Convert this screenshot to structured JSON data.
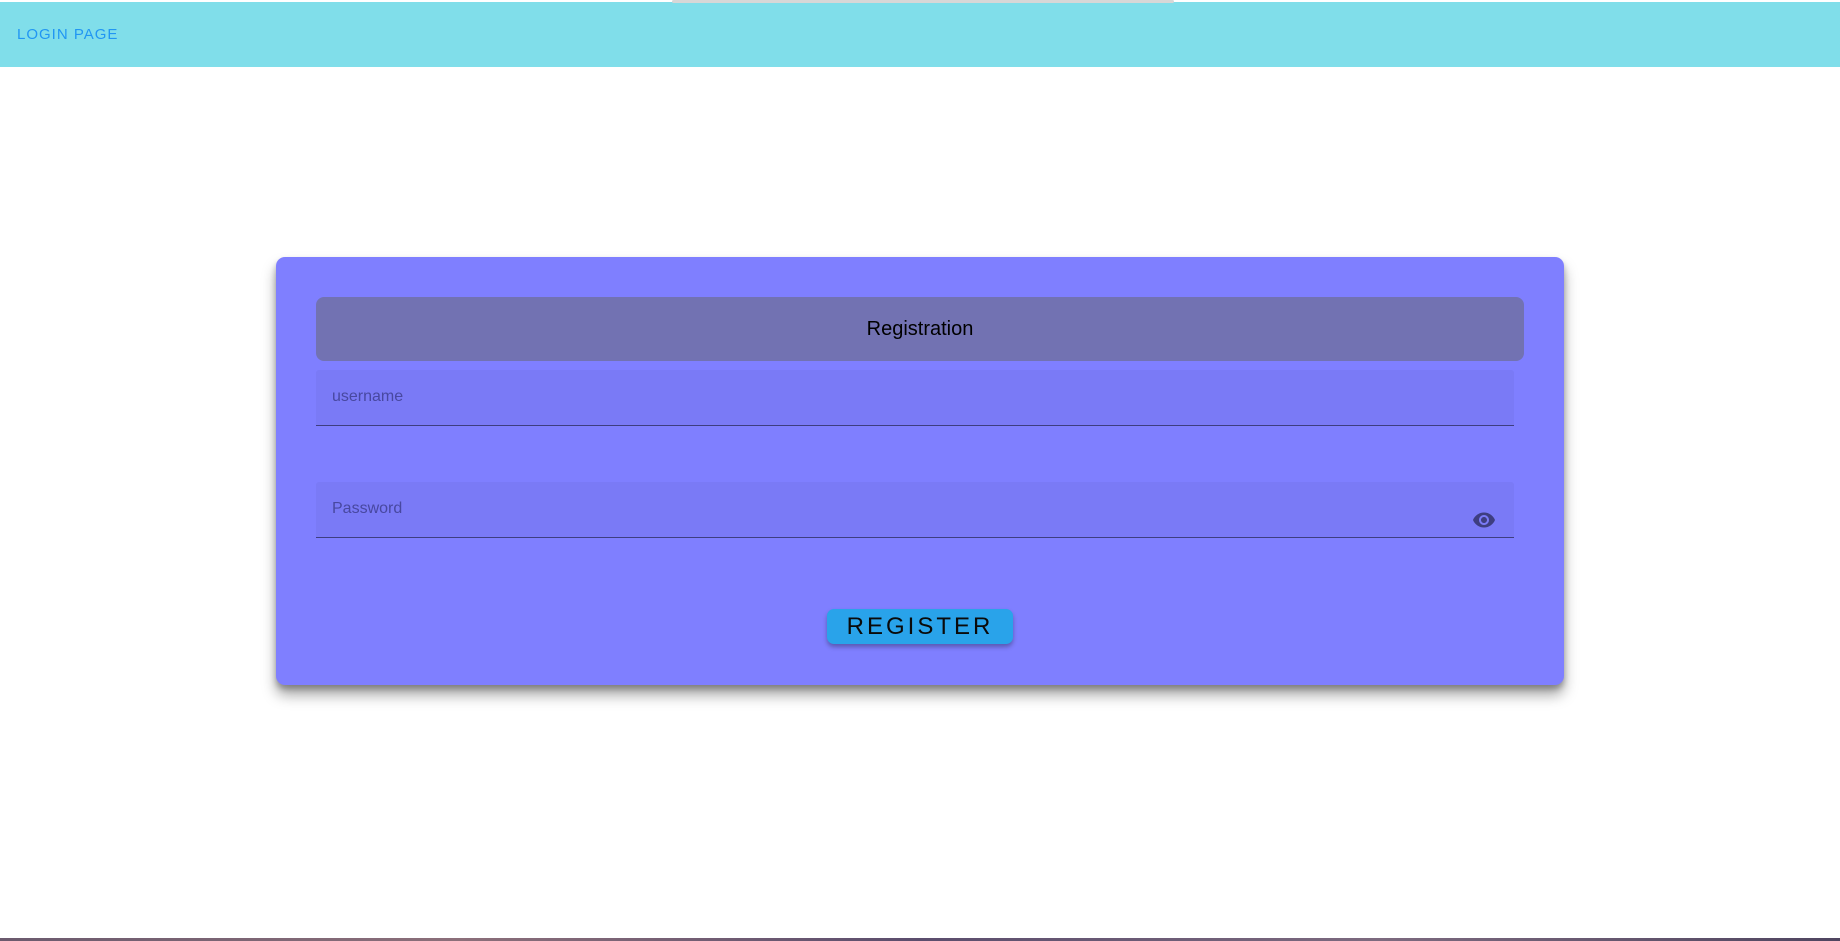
{
  "header": {
    "login_link": "LOGIN PAGE",
    "background": "#80deea",
    "link_color": "#2196f3"
  },
  "registration_card": {
    "title": "Registration",
    "background": "#7f7fff",
    "header_background": "#7272b2",
    "username": {
      "placeholder": "username",
      "value": ""
    },
    "password": {
      "placeholder": "Password",
      "value": "",
      "visibility_icon": "eye-icon"
    },
    "register_button": {
      "label": "REGISTER",
      "background": "#29a3ea"
    }
  }
}
